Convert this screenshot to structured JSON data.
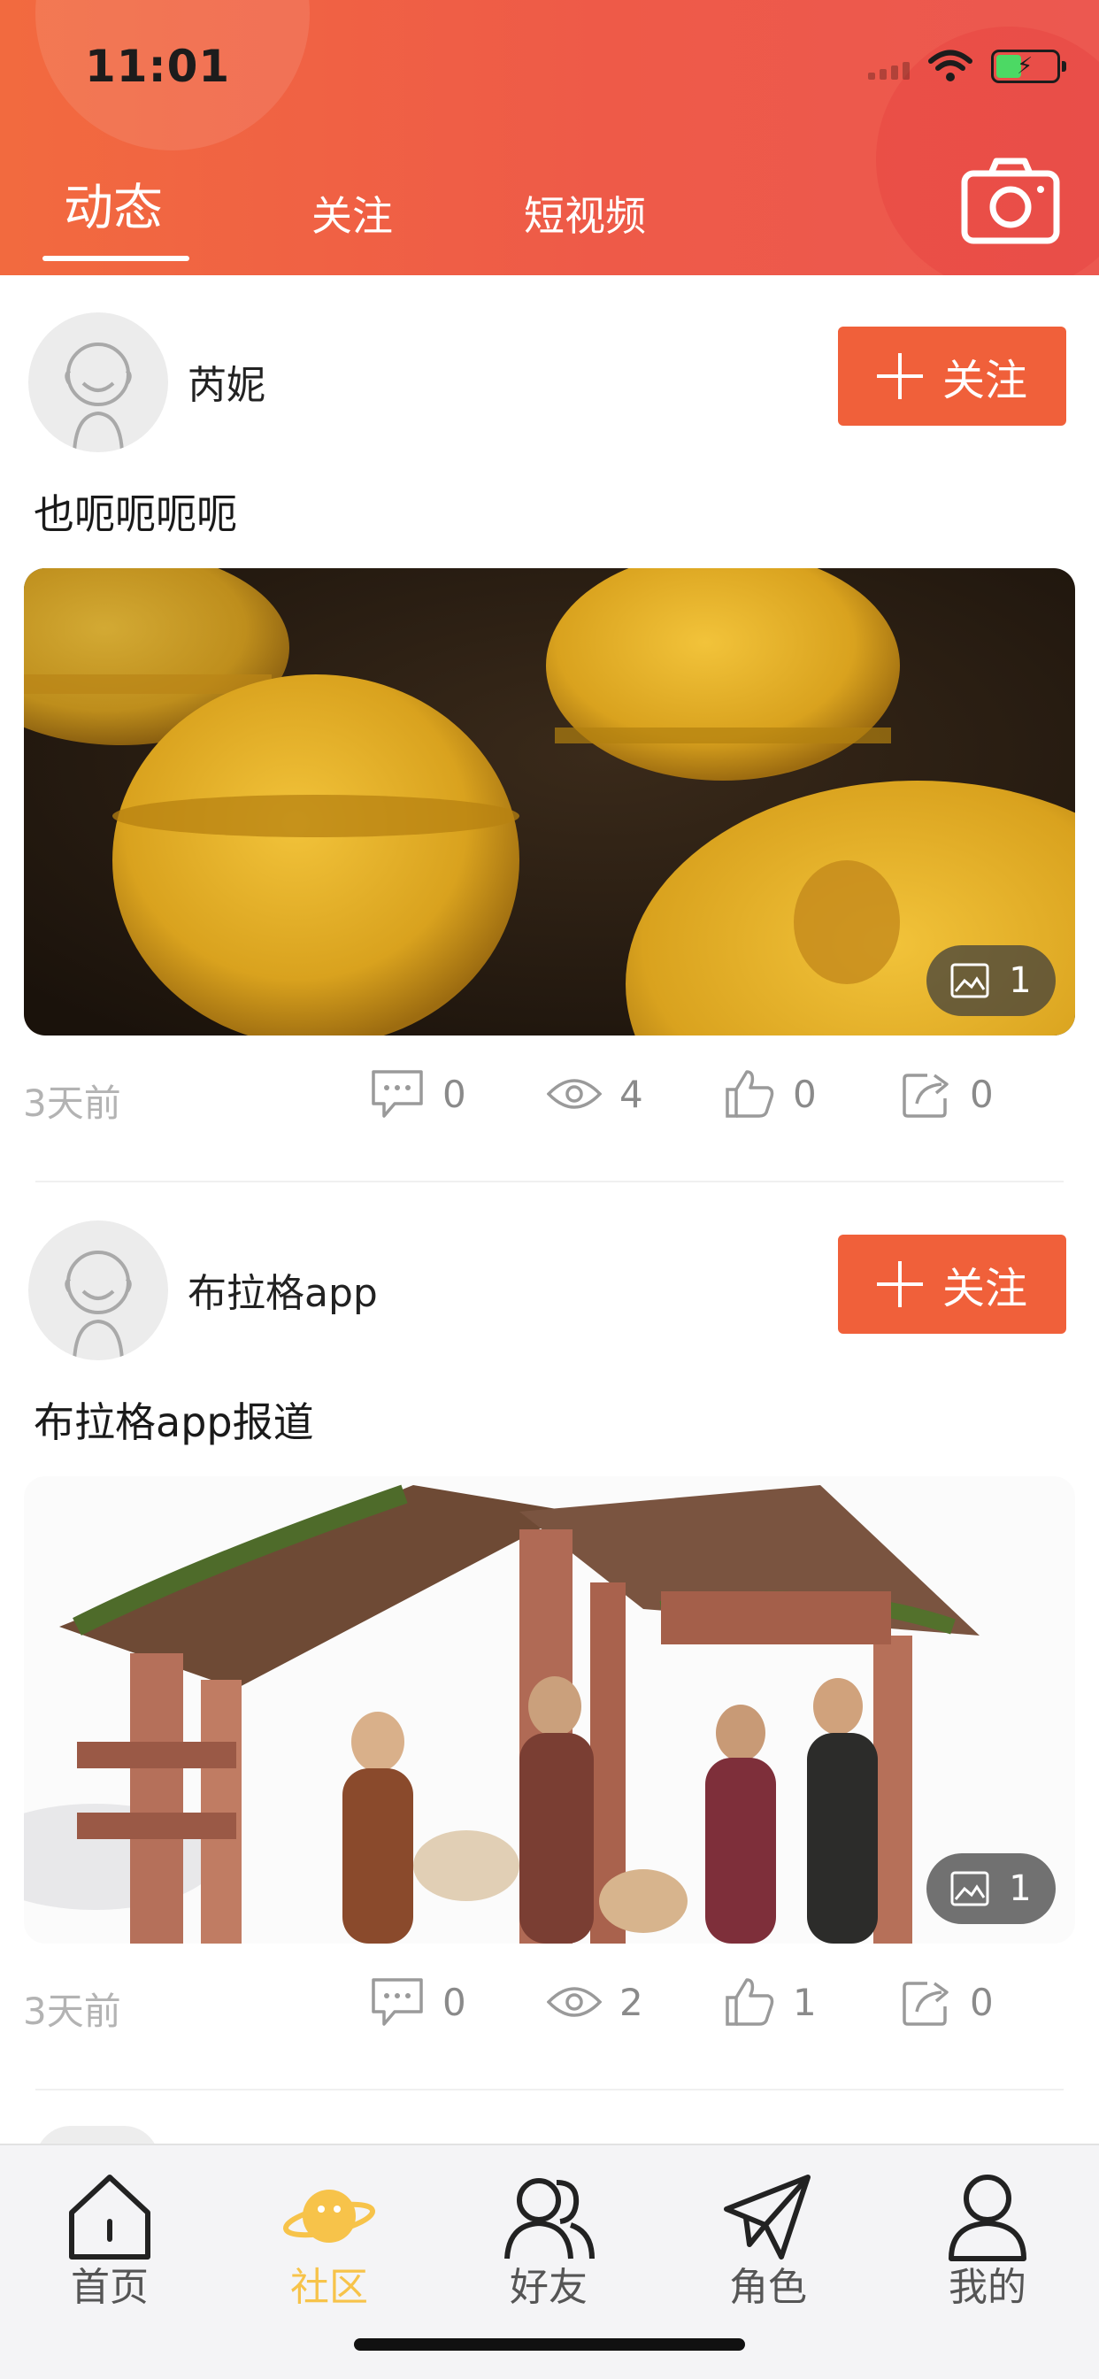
{
  "status_bar": {
    "time": "11:01"
  },
  "header": {
    "tabs": [
      {
        "label": "动态",
        "active": true
      },
      {
        "label": "关注",
        "active": false
      },
      {
        "label": "短视频",
        "active": false
      }
    ],
    "camera_icon": "camera-icon",
    "colors": {
      "gradient_start": "#f26a3f",
      "gradient_end": "#ec5850"
    }
  },
  "posts": [
    {
      "username": "芮妮",
      "follow_label": "关注",
      "text": "也呃呃呃呃",
      "image_desc": "macarons",
      "image_count": "1",
      "time": "3天前",
      "comments": "0",
      "views": "4",
      "likes": "0",
      "shares": "0"
    },
    {
      "username": "布拉格app",
      "follow_label": "关注",
      "text": "布拉格app报道",
      "image_desc": "nativity",
      "image_count": "1",
      "time": "3天前",
      "comments": "0",
      "views": "2",
      "likes": "1",
      "shares": "0"
    }
  ],
  "bottom_nav": {
    "items": [
      {
        "label": "首页",
        "icon": "home-icon",
        "active": false
      },
      {
        "label": "社区",
        "icon": "planet-icon",
        "active": true
      },
      {
        "label": "好友",
        "icon": "friends-icon",
        "active": false
      },
      {
        "label": "角色",
        "icon": "paper-plane-icon",
        "active": false
      },
      {
        "label": "我的",
        "icon": "profile-icon",
        "active": false
      }
    ],
    "active_color": "#f7c34a"
  },
  "colors": {
    "accent": "#f0603a",
    "muted_text": "#b3b3b3"
  }
}
